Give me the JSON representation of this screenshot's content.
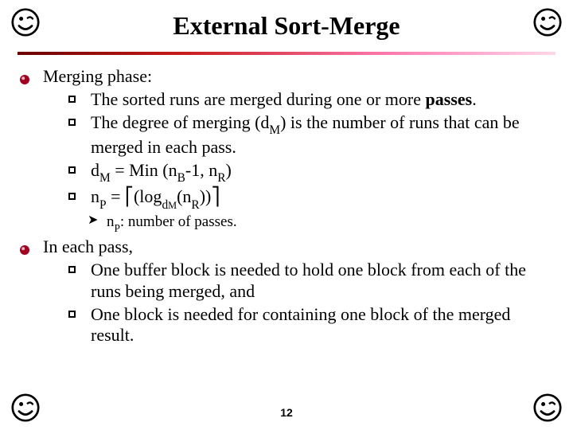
{
  "title": "External Sort-Merge",
  "sections": [
    {
      "heading": "Merging phase:",
      "items": [
        {
          "html": "The sorted runs are merged during one or more <b>passes</b>."
        },
        {
          "html": "The degree of merging (d<span class='sub'>M</span>) is the number of runs that can be merged in each pass."
        },
        {
          "html": "d<span class='sub'>M</span> = Min (n<span class='sub'>B</span>-1, n<span class='sub'>R</span>)"
        },
        {
          "html": "n<span class='sub'>P</span> = <span class='ceil'>⎡</span>(log<span class='sub'>d<span style='font-size:0.8em'>M</span></span>(n<span class='sub'>R</span>))<span class='ceil'>⎤</span>"
        }
      ],
      "subnotes": [
        {
          "html": "n<span class='sub'>P</span>: number of passes."
        }
      ]
    },
    {
      "heading": "In each pass,",
      "items": [
        {
          "html": "One buffer block is needed to hold one block from each of the runs being merged, and"
        },
        {
          "html": "One block is needed for containing one block of the merged result."
        }
      ]
    }
  ],
  "pageNumber": "12",
  "icons": {
    "corner": "smile-wink-icon",
    "l1bullet": "disc-bullet"
  }
}
